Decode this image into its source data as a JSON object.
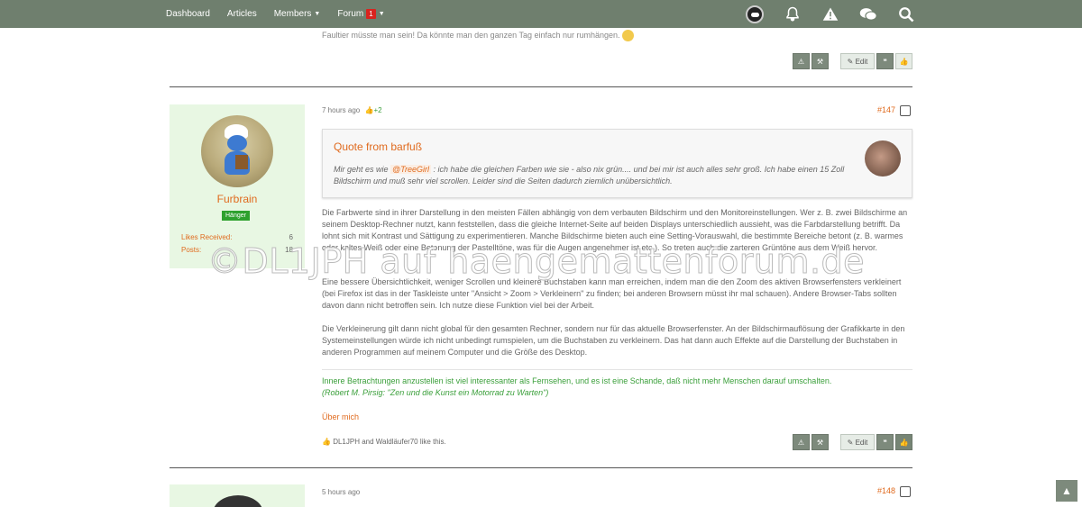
{
  "nav": {
    "dashboard": "Dashboard",
    "articles": "Articles",
    "members": "Members",
    "forum": "Forum",
    "forum_badge": "1"
  },
  "prev_post": {
    "text": "Faultier müsste man sein! Da könnte man den ganzen Tag einfach nur rumhängen."
  },
  "buttons": {
    "edit": "Edit"
  },
  "post147": {
    "time": "7 hours ago",
    "likes": "+2",
    "number": "#147",
    "user": {
      "name": "Furbrain",
      "rank": "Hänger",
      "likes_label": "Likes Received:",
      "likes_value": "6",
      "posts_label": "Posts:",
      "posts_value": "18"
    },
    "quote": {
      "title": "Quote from barfuß",
      "text_before": "Mir geht es wie",
      "mention": "@TreeGirl",
      "text_after": ": ich habe die gleichen Farben wie sie - also nix grün.... und bei mir ist auch alles sehr groß. Ich habe einen 15 Zoll Bildschirm und muß sehr viel scrollen. Leider sind die Seiten dadurch ziemlich unübersichtlich."
    },
    "para1": "Die Farbwerte sind in ihrer Darstellung in den meisten Fällen abhängig von dem verbauten Bildschirm und den Monitoreinstellungen. Wer z. B. zwei Bildschirme an seinem Desktop-Rechner nutzt, kann feststellen, dass die gleiche Internet-Seite auf beiden Displays unterschiedlich aussieht, was die Farbdarstellung betrifft. Da lohnt sich mit Kontrast und Sättigung zu experimentieren. Manche Bildschirme bieten auch eine Setting-Vorauswahl, die bestimmte Bereiche betont (z. B. warmes oder kaltes Weiß oder eine Betonung der Pastelltöne, was für die Augen angenehmer ist etc.). So treten auch die zarteren Grüntöne aus dem Weiß hervor.",
    "para2": "Eine bessere Übersichtlichkeit, weniger Scrollen und kleinere Buchstaben kann man erreichen, indem man die den Zoom des aktiven Browserfensters verkleinert (bei Firefox ist das in der Taskleiste unter \"Ansicht > Zoom > Verkleinern\" zu finden; bei anderen Browsern müsst ihr mal schauen). Andere Browser-Tabs sollten davon dann nicht betroffen sein. Ich nutze diese Funktion viel bei der Arbeit.",
    "para3": "Die Verkleinerung gilt dann nicht global für den gesamten Rechner, sondern nur für das aktuelle Browserfenster. An der Bildschirmauflösung der Grafikkarte in den Systemeinstellungen würde ich nicht unbedingt rumspielen, um die Buchstaben zu verkleinern. Das hat dann auch Effekte auf die Darstellung der Buchstaben in anderen Programmen auf meinem Computer und die Größe des Desktop.",
    "signature_line1": "Innere Betrachtungen anzustellen ist viel interessanter als Fernsehen, und es ist eine Schande, daß nicht mehr Menschen darauf umschalten.",
    "signature_line2": "(Robert M. Pirsig: \"Zen und die Kunst ein Motorrad zu Warten\")",
    "about": "Über mich",
    "liked_by": "DL1JPH and Waldläufer70 like this."
  },
  "post148": {
    "time": "5 hours ago",
    "number": "#148"
  },
  "watermark": "©DL1JPH auf haengemattenforum.de",
  "colors": {
    "nav_bg": "#6f7f6e",
    "accent_orange": "#e06b1f",
    "user_card_bg": "#e8f7e3",
    "signature_green": "#3a9f3a"
  }
}
